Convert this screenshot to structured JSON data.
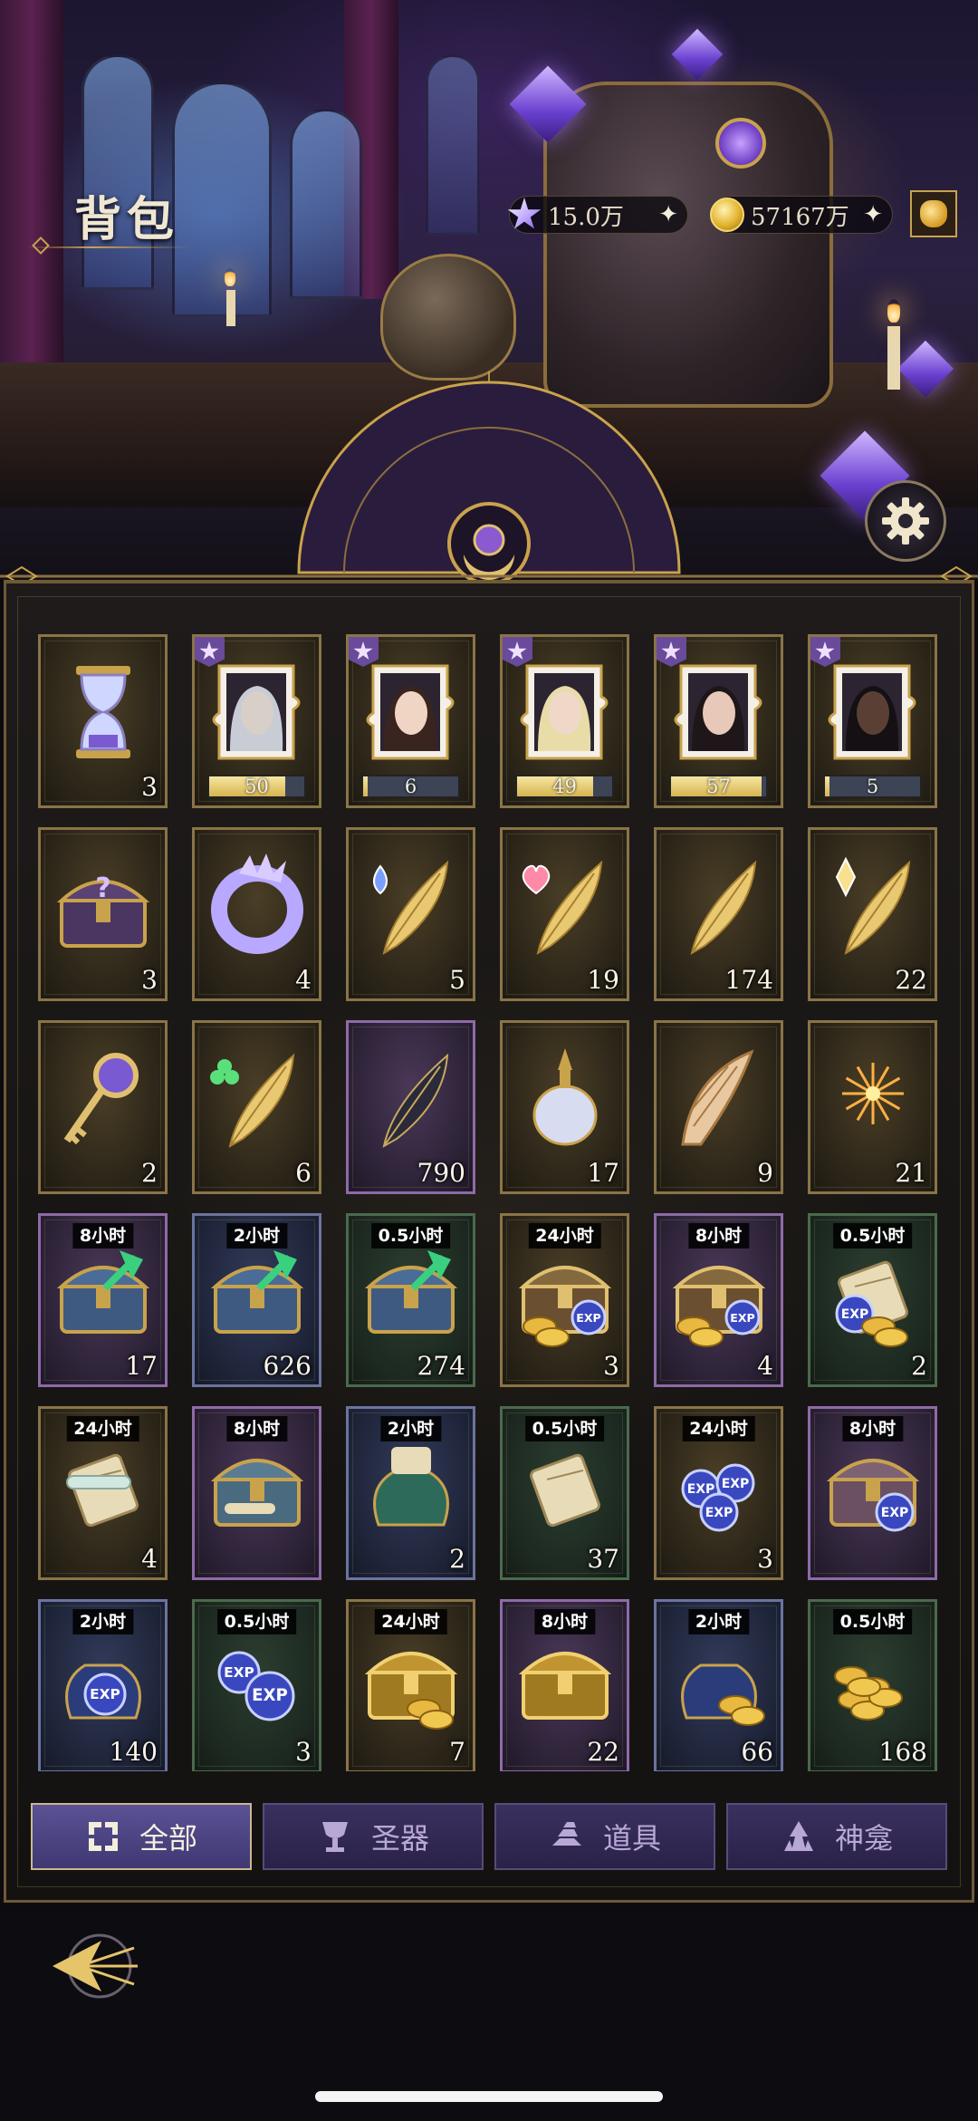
{
  "header": {
    "title": "背包",
    "currencies": [
      {
        "icon": "star-crystal-icon",
        "value": "15.0万"
      },
      {
        "icon": "gold-coin-icon",
        "value": "57167万"
      }
    ]
  },
  "items": [
    {
      "icon": "hourglass",
      "frame": "gold",
      "qty": "3"
    },
    {
      "icon": "puzzle-portrait-silver-hair",
      "frame": "gold",
      "qty": "50",
      "progress": 0.8,
      "badge": true
    },
    {
      "icon": "puzzle-portrait-dark-hair",
      "frame": "gold",
      "qty": "6",
      "progress": 0.05,
      "badge": true
    },
    {
      "icon": "puzzle-portrait-blonde",
      "frame": "gold",
      "qty": "49",
      "progress": 0.8,
      "badge": true
    },
    {
      "icon": "puzzle-portrait-black-hair",
      "frame": "gold",
      "qty": "57",
      "progress": 0.95,
      "badge": true
    },
    {
      "icon": "puzzle-portrait-dark-skin",
      "frame": "gold",
      "qty": "5",
      "progress": 0.05,
      "badge": true
    },
    {
      "icon": "mystery-chest",
      "frame": "gold",
      "qty": "3"
    },
    {
      "icon": "crystal-ring",
      "frame": "gold",
      "qty": "4"
    },
    {
      "icon": "feather-spade",
      "frame": "gold",
      "qty": "5"
    },
    {
      "icon": "feather-heart",
      "frame": "gold",
      "qty": "19"
    },
    {
      "icon": "feather-plain",
      "frame": "gold",
      "qty": "174"
    },
    {
      "icon": "feather-diamond",
      "frame": "gold",
      "qty": "22"
    },
    {
      "icon": "golden-key",
      "frame": "gold",
      "qty": "2"
    },
    {
      "icon": "feather-club",
      "frame": "gold",
      "qty": "6"
    },
    {
      "icon": "dark-feather",
      "frame": "purple",
      "qty": "790"
    },
    {
      "icon": "perfume-bottle",
      "frame": "gold",
      "qty": "17"
    },
    {
      "icon": "seashell-horn",
      "frame": "gold",
      "qty": "9"
    },
    {
      "icon": "fireworks",
      "frame": "gold",
      "qty": "21"
    },
    {
      "icon": "chest-arrow",
      "frame": "purple",
      "qty": "17",
      "timer": "8小时"
    },
    {
      "icon": "chest-arrow",
      "frame": "blue",
      "qty": "626",
      "timer": "2小时"
    },
    {
      "icon": "chest-arrow",
      "frame": "green",
      "qty": "274",
      "timer": "0.5小时"
    },
    {
      "icon": "chest-scrolls-exp",
      "frame": "gold",
      "qty": "3",
      "timer": "24小时"
    },
    {
      "icon": "chest-scrolls-exp",
      "frame": "purple",
      "qty": "4",
      "timer": "8小时"
    },
    {
      "icon": "scroll-exp-coins",
      "frame": "green",
      "qty": "2",
      "timer": "0.5小时"
    },
    {
      "icon": "scroll-bundle",
      "frame": "gold",
      "qty": "4",
      "timer": "24小时"
    },
    {
      "icon": "chest-scrolls",
      "frame": "purple",
      "qty": "",
      "timer": "8小时"
    },
    {
      "icon": "scroll-pouch",
      "frame": "blue",
      "qty": "2",
      "timer": "2小时"
    },
    {
      "icon": "scroll-single",
      "frame": "green",
      "qty": "37",
      "timer": "0.5小时"
    },
    {
      "icon": "exp-orb-pile",
      "frame": "gold",
      "qty": "3",
      "timer": "24小时"
    },
    {
      "icon": "chest-exp",
      "frame": "purple",
      "qty": "",
      "timer": "8小时"
    },
    {
      "icon": "exp-pouch",
      "frame": "blue",
      "qty": "140",
      "timer": "2小时"
    },
    {
      "icon": "exp-orbs",
      "frame": "green",
      "qty": "3",
      "timer": "0.5小时"
    },
    {
      "icon": "gold-chest",
      "frame": "gold",
      "qty": "7",
      "timer": "24小时"
    },
    {
      "icon": "gold-chest-small",
      "frame": "purple",
      "qty": "22",
      "timer": "8小时"
    },
    {
      "icon": "coin-pouch",
      "frame": "blue",
      "qty": "66",
      "timer": "2小时"
    },
    {
      "icon": "coin-stack",
      "frame": "green",
      "qty": "168",
      "timer": "0.5小时"
    }
  ],
  "tabs": [
    {
      "label": "全部",
      "icon": "all-grid-icon",
      "active": true
    },
    {
      "label": "圣器",
      "icon": "chalice-icon",
      "active": false
    },
    {
      "label": "道具",
      "icon": "ingots-icon",
      "active": false
    },
    {
      "label": "神龛",
      "icon": "shrine-icon",
      "active": false
    }
  ],
  "colors": {
    "accent_gold": "#c9a24c",
    "frame_purple": "#8e6aa8",
    "frame_blue": "#6a74a0",
    "frame_green": "#4a6a4c",
    "tab_active": "#5a5294"
  }
}
